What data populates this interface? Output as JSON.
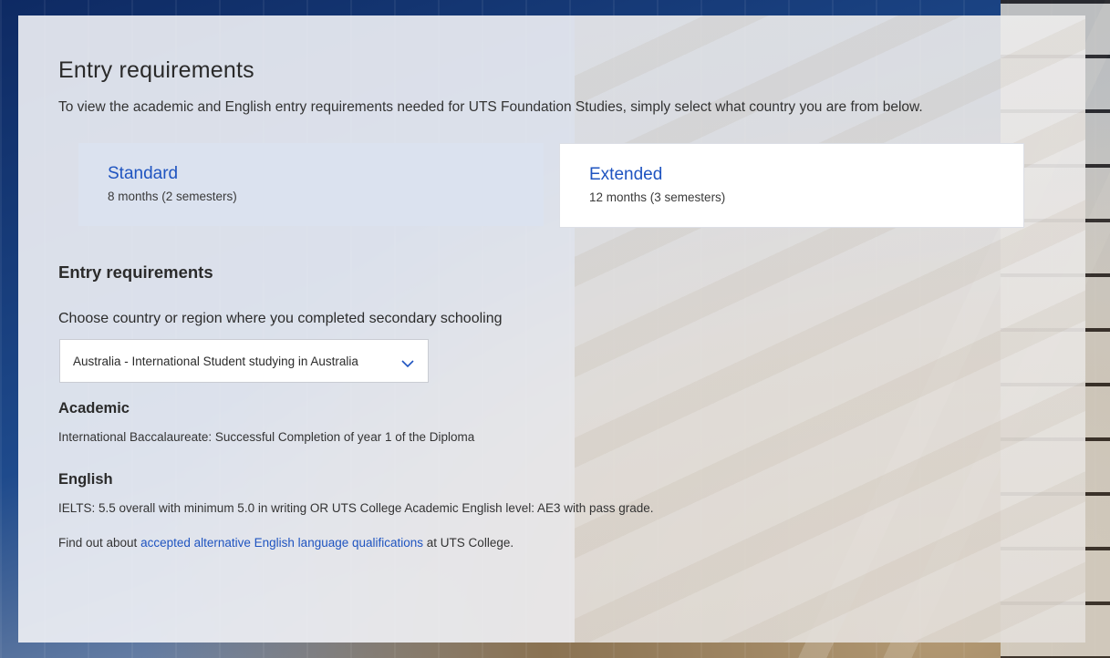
{
  "page": {
    "title": "Entry requirements",
    "intro": "To view the academic and English entry requirements needed for UTS Foundation Studies, simply select what country you are from below."
  },
  "options": [
    {
      "title": "Standard",
      "subtitle": "8 months (2 semesters)",
      "selected": true
    },
    {
      "title": "Extended",
      "subtitle": "12 months (3 semesters)",
      "selected": false
    }
  ],
  "requirements": {
    "section_title": "Entry requirements",
    "select_label": "Choose country or region where you completed secondary schooling",
    "select_value": "Australia - International Student studying in Australia",
    "academic_heading": "Academic",
    "academic_text": "International Baccalaureate: Successful Completion of year 1 of the Diploma",
    "english_heading": "English",
    "english_text": "IELTS: 5.5 overall with minimum 5.0 in writing OR UTS College Academic English level: AE3 with pass grade.",
    "findout_prefix": "Find out about ",
    "findout_link": "accepted alternative English language qualifications",
    "findout_suffix": " at UTS College."
  },
  "colors": {
    "accent": "#1f54c0",
    "selected_card": "#dbe2ef"
  },
  "icons": {
    "select": "chevron-down-icon"
  }
}
